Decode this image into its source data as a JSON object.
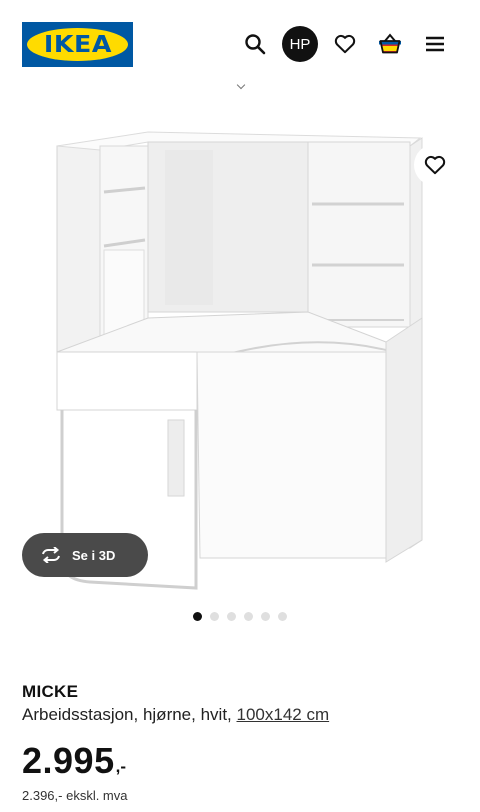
{
  "header": {
    "logo_text": "IKEA",
    "account_initials": "HP",
    "icons": [
      "search-icon",
      "heart-icon",
      "basket-icon",
      "menu-icon"
    ],
    "brand_blue": "#0058a3",
    "brand_yellow": "#ffdb00"
  },
  "gallery": {
    "view_3d_label": "Se i 3D",
    "image_count": 6,
    "active_image": 1
  },
  "product": {
    "name": "MICKE",
    "description": "Arbeidsstasjon, hjørne, hvit,",
    "dimensions": "100x142 cm",
    "price": "2.995",
    "price_suffix": ",-",
    "price_ex_vat": "2.396,- ekskl. mva"
  }
}
